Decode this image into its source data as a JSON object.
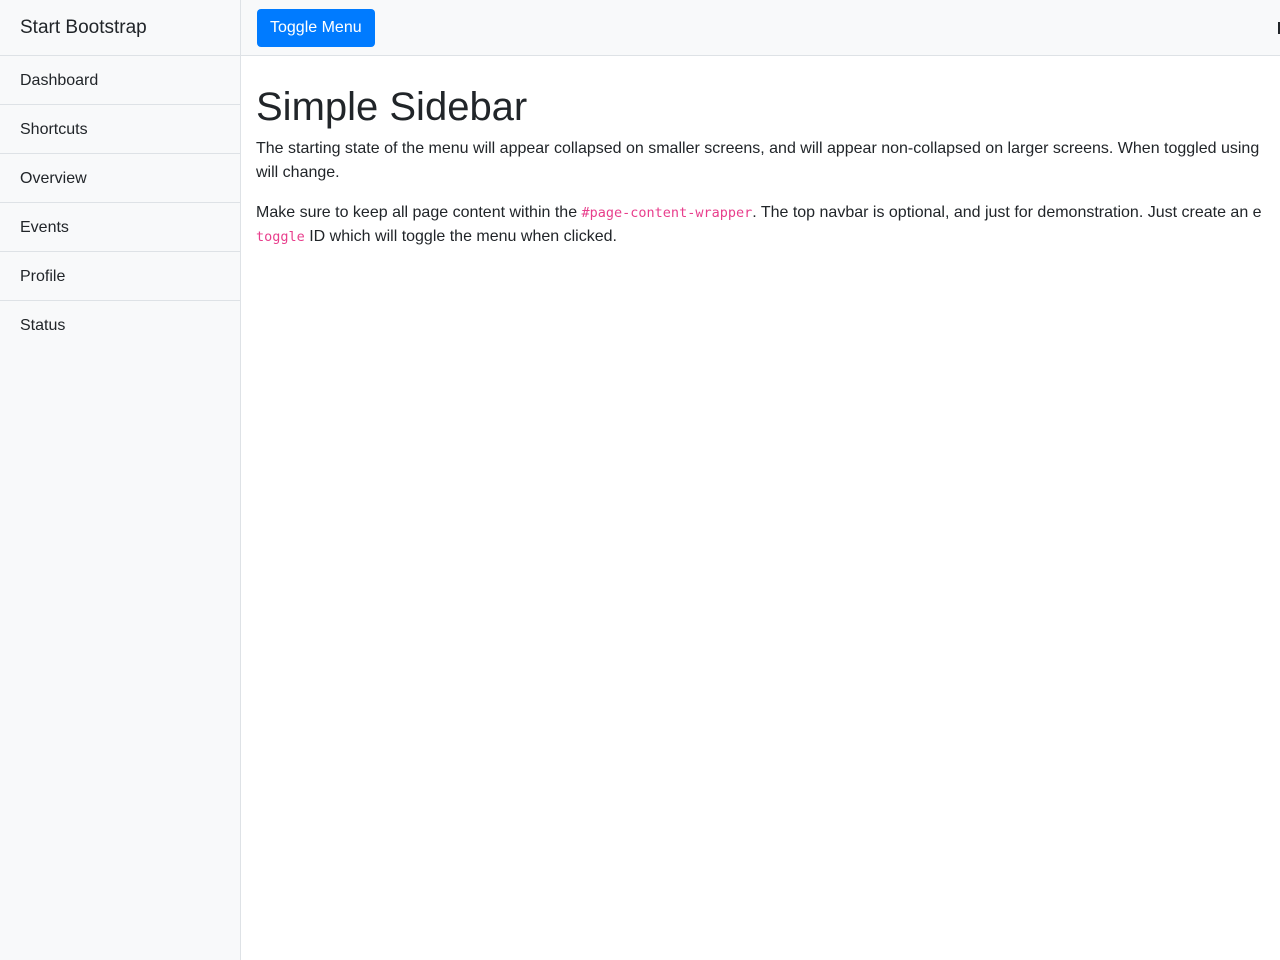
{
  "sidebar": {
    "brand": "Start Bootstrap",
    "items": [
      {
        "label": "Dashboard"
      },
      {
        "label": "Shortcuts"
      },
      {
        "label": "Overview"
      },
      {
        "label": "Events"
      },
      {
        "label": "Profile"
      },
      {
        "label": "Status"
      }
    ]
  },
  "navbar": {
    "toggle_label": "Toggle Menu"
  },
  "main": {
    "title": "Simple Sidebar",
    "p1": {
      "line1": "The starting state of the menu will appear collapsed on smaller screens, and will appear non-collapsed on larger screens. When toggled using",
      "line2": "will change."
    },
    "p2": {
      "before": "Make sure to keep all page content within the ",
      "code1": "#page-content-wrapper",
      "after": ". The top navbar is optional, and just for demonstration. Just create an e",
      "code2": "toggle",
      "end": " ID which will toggle the menu when clicked."
    }
  },
  "colors": {
    "accent": "#007bff",
    "code": "#e83e8c",
    "sidebar_bg": "#f8f9fa"
  }
}
